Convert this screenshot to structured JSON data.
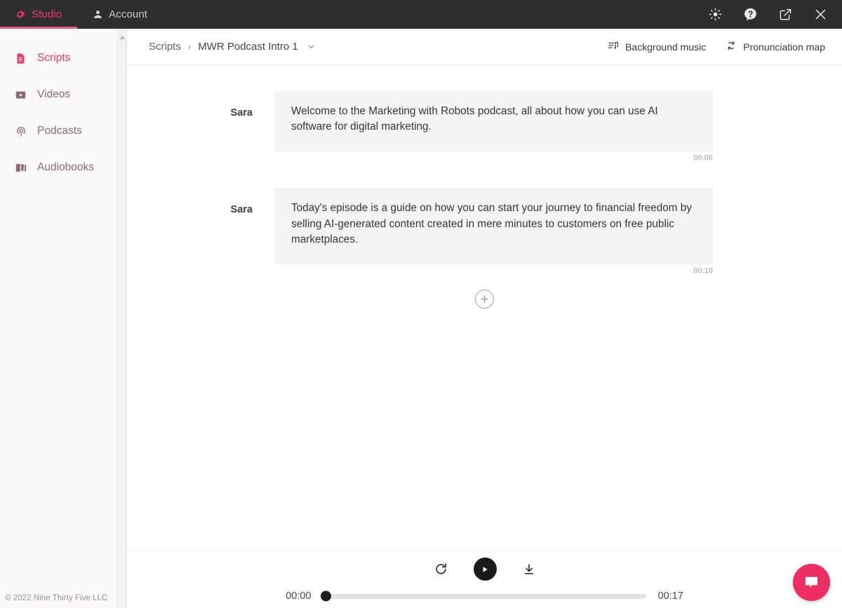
{
  "topbar": {
    "tabs": [
      {
        "label": "Studio",
        "icon": "gear-icon",
        "active": true
      },
      {
        "label": "Account",
        "icon": "person-icon",
        "active": false
      }
    ],
    "actions": [
      {
        "name": "brightness-icon",
        "title": "Brightness"
      },
      {
        "name": "help-icon",
        "title": "Help"
      },
      {
        "name": "external-link-icon",
        "title": "Open in new window"
      },
      {
        "name": "close-icon",
        "title": "Close"
      }
    ],
    "accent_color": "#ea3a66",
    "background_color": "#2e2e2e"
  },
  "sidebar": {
    "items": [
      {
        "label": "Scripts",
        "icon": "document-icon",
        "active": true
      },
      {
        "label": "Videos",
        "icon": "video-icon",
        "active": false
      },
      {
        "label": "Podcasts",
        "icon": "podcast-icon",
        "active": false
      },
      {
        "label": "Audiobooks",
        "icon": "book-icon",
        "active": false
      }
    ],
    "footer": "© 2022 Nine Thirty Five LLC",
    "active_color": "#e8386a",
    "inactive_color": "#8e6a74"
  },
  "header": {
    "breadcrumb_root": "Scripts",
    "breadcrumb_separator": "›",
    "breadcrumb_current": "MWR Podcast Intro 1",
    "actions": [
      {
        "label": "Background music",
        "icon": "music-lines-icon"
      },
      {
        "label": "Pronunciation map",
        "icon": "refresh-cycle-icon"
      }
    ]
  },
  "script": {
    "blocks": [
      {
        "speaker": "Sara",
        "text": "Welcome to the Marketing with Robots podcast, all about how you can use AI software for digital marketing.",
        "duration": "00:06"
      },
      {
        "speaker": "Sara",
        "text": "Today's episode is a guide on how you can start your journey to financial freedom by selling AI-generated content created in mere minutes to customers on free public marketplaces.",
        "duration": "00:10"
      }
    ],
    "add_block_label": "+"
  },
  "player": {
    "controls": [
      {
        "name": "restart-icon",
        "label": "Restart"
      },
      {
        "name": "play-icon",
        "label": "Play"
      },
      {
        "name": "download-icon",
        "label": "Download"
      }
    ],
    "current_time": "00:00",
    "total_time": "00:17",
    "progress_percent": 0
  },
  "chat": {
    "icon": "chat-bubble-icon",
    "color": "#ec2e63"
  }
}
